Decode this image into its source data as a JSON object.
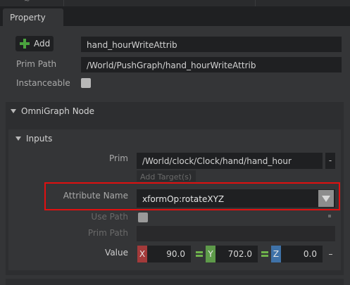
{
  "top_strip": {
    "glyph": "~"
  },
  "tab": {
    "label": "Property"
  },
  "prim": {
    "add_button_label": "Add",
    "name_value": "hand_hourWriteAttrib",
    "prim_path_label": "Prim Path",
    "prim_path_value": "/World/PushGraph/hand_hourWriteAttrib",
    "instanceable_label": "Instanceable"
  },
  "omnigraph_section": {
    "title": "OmniGraph Node"
  },
  "inputs_section": {
    "title": "Inputs",
    "prim_label": "Prim",
    "prim_target": "/World/clock/Clock/hand/hand_hour",
    "remove_target": "-",
    "add_target_label": "Add Target(s)",
    "attribute_name_label": "Attribute Name",
    "attribute_name_value": "xformOp:rotateXYZ",
    "use_path_label": "Use Path",
    "prim_path_label": "Prim Path",
    "value_label": "Value",
    "value": {
      "x_label": "X",
      "x": "90.0",
      "y_label": "Y",
      "y": "702.0",
      "z_label": "Z",
      "z": "0.0"
    }
  },
  "colors": {
    "highlight": "#e01010",
    "add_plus": "#4aa33e",
    "axis_x": "#a33a3a",
    "axis_y": "#5e9a4a",
    "axis_z": "#3f72a8"
  }
}
